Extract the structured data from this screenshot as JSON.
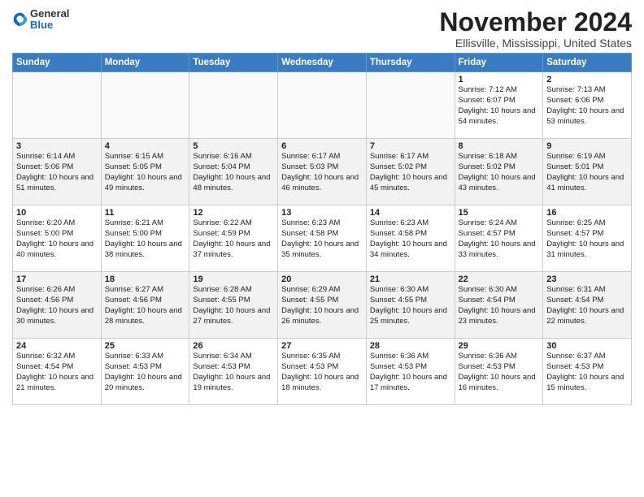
{
  "header": {
    "logo_line1": "General",
    "logo_line2": "Blue",
    "month": "November 2024",
    "location": "Ellisville, Mississippi, United States"
  },
  "weekdays": [
    "Sunday",
    "Monday",
    "Tuesday",
    "Wednesday",
    "Thursday",
    "Friday",
    "Saturday"
  ],
  "weeks": [
    [
      {
        "day": "",
        "info": ""
      },
      {
        "day": "",
        "info": ""
      },
      {
        "day": "",
        "info": ""
      },
      {
        "day": "",
        "info": ""
      },
      {
        "day": "",
        "info": ""
      },
      {
        "day": "1",
        "info": "Sunrise: 7:12 AM\nSunset: 6:07 PM\nDaylight: 10 hours and 54 minutes."
      },
      {
        "day": "2",
        "info": "Sunrise: 7:13 AM\nSunset: 6:06 PM\nDaylight: 10 hours and 53 minutes."
      }
    ],
    [
      {
        "day": "3",
        "info": "Sunrise: 6:14 AM\nSunset: 5:06 PM\nDaylight: 10 hours and 51 minutes."
      },
      {
        "day": "4",
        "info": "Sunrise: 6:15 AM\nSunset: 5:05 PM\nDaylight: 10 hours and 49 minutes."
      },
      {
        "day": "5",
        "info": "Sunrise: 6:16 AM\nSunset: 5:04 PM\nDaylight: 10 hours and 48 minutes."
      },
      {
        "day": "6",
        "info": "Sunrise: 6:17 AM\nSunset: 5:03 PM\nDaylight: 10 hours and 46 minutes."
      },
      {
        "day": "7",
        "info": "Sunrise: 6:17 AM\nSunset: 5:02 PM\nDaylight: 10 hours and 45 minutes."
      },
      {
        "day": "8",
        "info": "Sunrise: 6:18 AM\nSunset: 5:02 PM\nDaylight: 10 hours and 43 minutes."
      },
      {
        "day": "9",
        "info": "Sunrise: 6:19 AM\nSunset: 5:01 PM\nDaylight: 10 hours and 41 minutes."
      }
    ],
    [
      {
        "day": "10",
        "info": "Sunrise: 6:20 AM\nSunset: 5:00 PM\nDaylight: 10 hours and 40 minutes."
      },
      {
        "day": "11",
        "info": "Sunrise: 6:21 AM\nSunset: 5:00 PM\nDaylight: 10 hours and 38 minutes."
      },
      {
        "day": "12",
        "info": "Sunrise: 6:22 AM\nSunset: 4:59 PM\nDaylight: 10 hours and 37 minutes."
      },
      {
        "day": "13",
        "info": "Sunrise: 6:23 AM\nSunset: 4:58 PM\nDaylight: 10 hours and 35 minutes."
      },
      {
        "day": "14",
        "info": "Sunrise: 6:23 AM\nSunset: 4:58 PM\nDaylight: 10 hours and 34 minutes."
      },
      {
        "day": "15",
        "info": "Sunrise: 6:24 AM\nSunset: 4:57 PM\nDaylight: 10 hours and 33 minutes."
      },
      {
        "day": "16",
        "info": "Sunrise: 6:25 AM\nSunset: 4:57 PM\nDaylight: 10 hours and 31 minutes."
      }
    ],
    [
      {
        "day": "17",
        "info": "Sunrise: 6:26 AM\nSunset: 4:56 PM\nDaylight: 10 hours and 30 minutes."
      },
      {
        "day": "18",
        "info": "Sunrise: 6:27 AM\nSunset: 4:56 PM\nDaylight: 10 hours and 28 minutes."
      },
      {
        "day": "19",
        "info": "Sunrise: 6:28 AM\nSunset: 4:55 PM\nDaylight: 10 hours and 27 minutes."
      },
      {
        "day": "20",
        "info": "Sunrise: 6:29 AM\nSunset: 4:55 PM\nDaylight: 10 hours and 26 minutes."
      },
      {
        "day": "21",
        "info": "Sunrise: 6:30 AM\nSunset: 4:55 PM\nDaylight: 10 hours and 25 minutes."
      },
      {
        "day": "22",
        "info": "Sunrise: 6:30 AM\nSunset: 4:54 PM\nDaylight: 10 hours and 23 minutes."
      },
      {
        "day": "23",
        "info": "Sunrise: 6:31 AM\nSunset: 4:54 PM\nDaylight: 10 hours and 22 minutes."
      }
    ],
    [
      {
        "day": "24",
        "info": "Sunrise: 6:32 AM\nSunset: 4:54 PM\nDaylight: 10 hours and 21 minutes."
      },
      {
        "day": "25",
        "info": "Sunrise: 6:33 AM\nSunset: 4:53 PM\nDaylight: 10 hours and 20 minutes."
      },
      {
        "day": "26",
        "info": "Sunrise: 6:34 AM\nSunset: 4:53 PM\nDaylight: 10 hours and 19 minutes."
      },
      {
        "day": "27",
        "info": "Sunrise: 6:35 AM\nSunset: 4:53 PM\nDaylight: 10 hours and 18 minutes."
      },
      {
        "day": "28",
        "info": "Sunrise: 6:36 AM\nSunset: 4:53 PM\nDaylight: 10 hours and 17 minutes."
      },
      {
        "day": "29",
        "info": "Sunrise: 6:36 AM\nSunset: 4:53 PM\nDaylight: 10 hours and 16 minutes."
      },
      {
        "day": "30",
        "info": "Sunrise: 6:37 AM\nSunset: 4:53 PM\nDaylight: 10 hours and 15 minutes."
      }
    ]
  ]
}
